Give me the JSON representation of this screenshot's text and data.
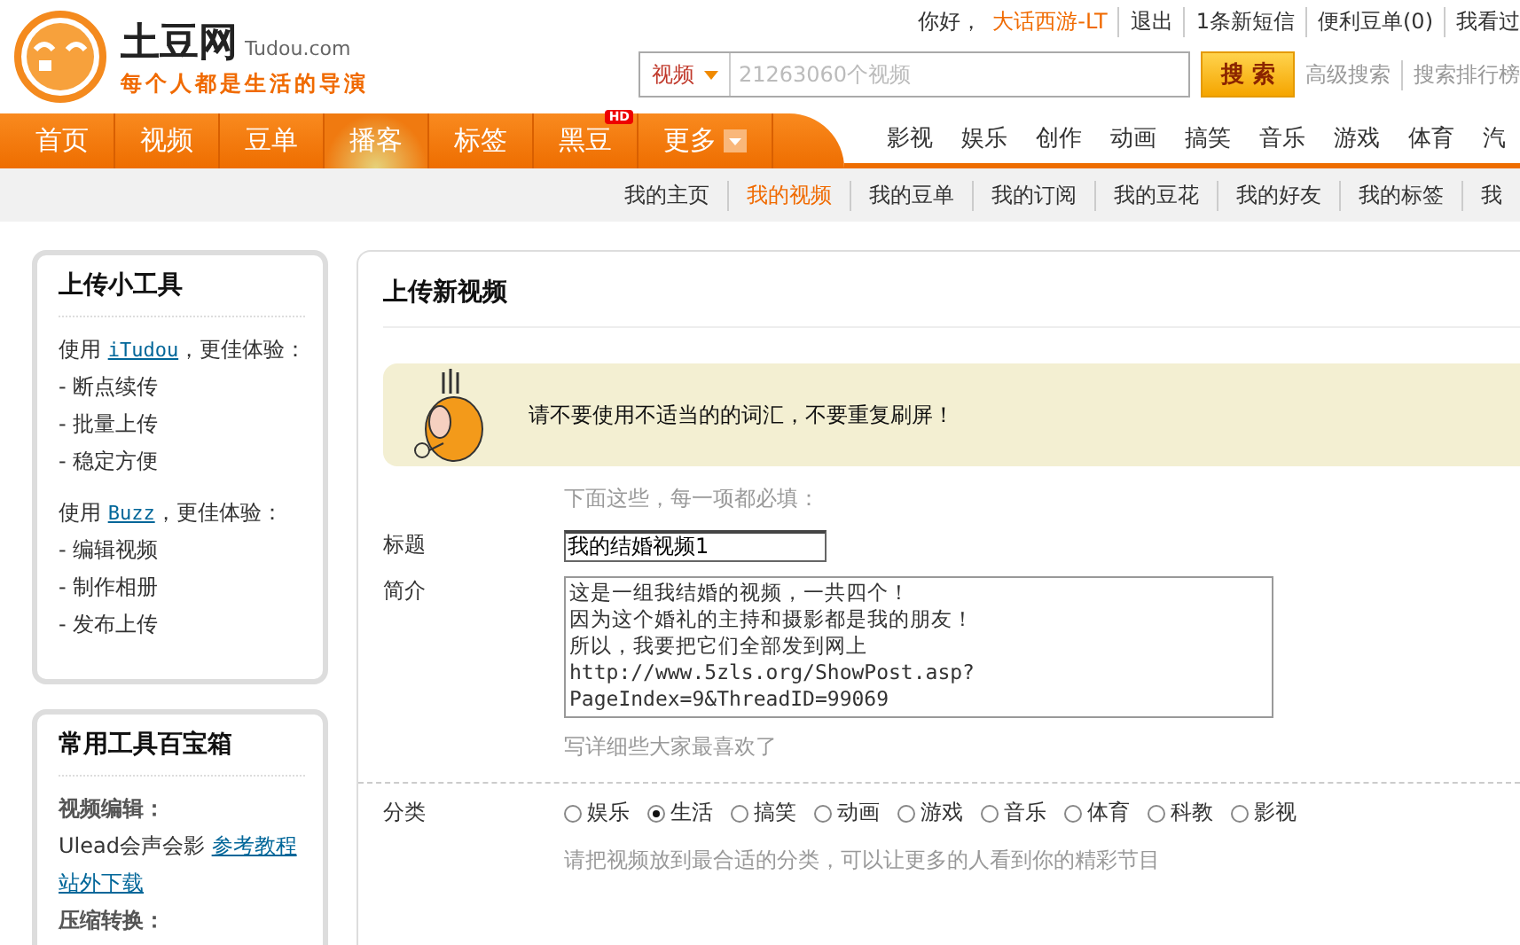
{
  "logo": {
    "name": "土豆网",
    "domain": "Tudou.com",
    "slogan": "每个人都是生活的导演"
  },
  "user_bar": {
    "greeting": "你好，",
    "username": "大话西游-LT",
    "links": [
      "退出",
      "1条新短信",
      "便利豆单(0)",
      "我看过"
    ]
  },
  "search": {
    "scope": "视频",
    "placeholder": "21263060个视频",
    "button": "搜 索",
    "links": [
      "高级搜索",
      "搜索排行榜"
    ]
  },
  "main_nav": [
    {
      "label": "首页",
      "selected": false
    },
    {
      "label": "视频",
      "selected": false
    },
    {
      "label": "豆单",
      "selected": false
    },
    {
      "label": "播客",
      "selected": true
    },
    {
      "label": "标签",
      "selected": false
    },
    {
      "label": "黑豆",
      "selected": false,
      "badge": "HD"
    },
    {
      "label": "更多",
      "selected": false,
      "dropdown": true
    }
  ],
  "channel_nav": [
    "影视",
    "娱乐",
    "创作",
    "动画",
    "搞笑",
    "音乐",
    "游戏",
    "体育",
    "汽"
  ],
  "sub_nav": [
    {
      "label": "我的主页",
      "selected": false
    },
    {
      "label": "我的视频",
      "selected": true
    },
    {
      "label": "我的豆单",
      "selected": false
    },
    {
      "label": "我的订阅",
      "selected": false
    },
    {
      "label": "我的豆花",
      "selected": false
    },
    {
      "label": "我的好友",
      "selected": false
    },
    {
      "label": "我的标签",
      "selected": false
    },
    {
      "label": "我",
      "selected": false
    }
  ],
  "sidebar": [
    {
      "title": "上传小工具",
      "groups": [
        {
          "intro": "使用 ",
          "link": "iTudou",
          "after": "，更佳体验：",
          "items": [
            "- 断点续传",
            "- 批量上传",
            "- 稳定方便"
          ]
        },
        {
          "intro": "使用 ",
          "link": "Buzz",
          "after": "，更佳体验：",
          "items": [
            "- 编辑视频",
            "- 制作相册",
            "- 发布上传"
          ]
        }
      ]
    },
    {
      "title": "常用工具百宝箱",
      "sections": [
        {
          "heading": "视频编辑：",
          "text": "Ulead会声会影",
          "links": [
            "参考教程",
            "站外下载"
          ]
        },
        {
          "heading": "压缩转换："
        }
      ]
    }
  ],
  "upload": {
    "title": "上传新视频",
    "notice": "请不要使用不适当的的词汇，不要重复刷屏！",
    "required_hint": "下面这些，每一项都必填：",
    "title_label": "标题",
    "title_value": "我的结婚视频1",
    "desc_label": "简介",
    "desc_lines": [
      "这是一组我结婚的视频，一共四个！",
      "因为这个婚礼的主持和摄影都是我的朋友！",
      "所以，我要把它们全部发到网上",
      "http://www.5zls.org/ShowPost.asp?",
      "PageIndex=9&ThreadID=99069"
    ],
    "desc_hint": "写详细些大家最喜欢了",
    "category_label": "分类",
    "categories": [
      {
        "label": "娱乐",
        "selected": false
      },
      {
        "label": "生活",
        "selected": true
      },
      {
        "label": "搞笑",
        "selected": false
      },
      {
        "label": "动画",
        "selected": false
      },
      {
        "label": "游戏",
        "selected": false
      },
      {
        "label": "音乐",
        "selected": false
      },
      {
        "label": "体育",
        "selected": false
      },
      {
        "label": "科教",
        "selected": false
      },
      {
        "label": "影视",
        "selected": false
      }
    ],
    "category_hint": "请把视频放到最合适的分类，可以让更多的人看到你的精彩节目"
  }
}
